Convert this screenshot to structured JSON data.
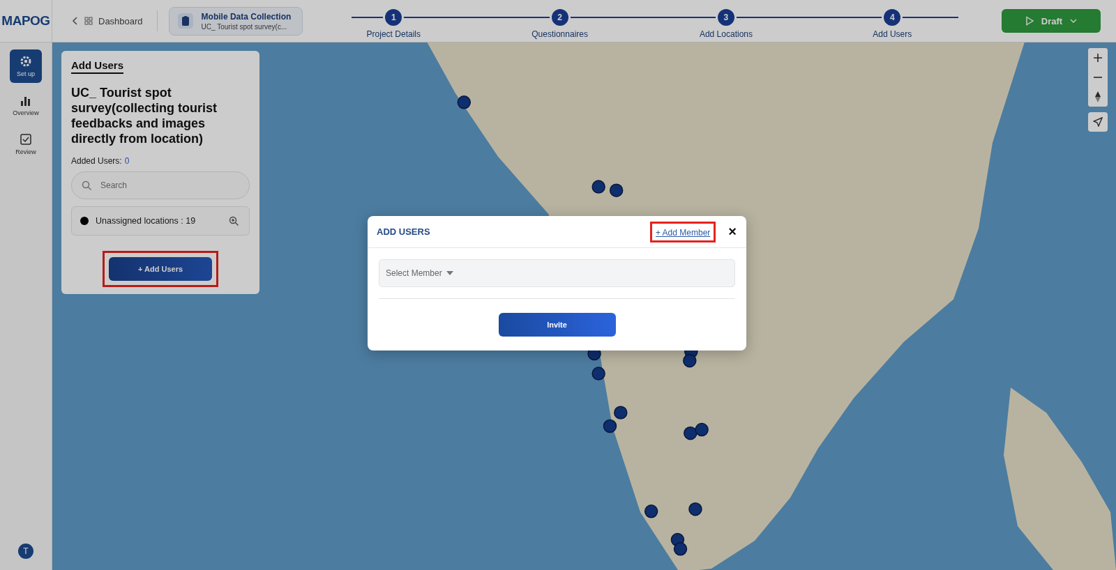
{
  "brand": {
    "logo": "MAPOG"
  },
  "breadcrumb": {
    "label": "Dashboard"
  },
  "project": {
    "title": "Mobile Data Collection",
    "subtitle": "UC_ Tourist spot survey(c..."
  },
  "steps": [
    {
      "number": "1",
      "label": "Project Details"
    },
    {
      "number": "2",
      "label": "Questionnaires"
    },
    {
      "number": "3",
      "label": "Add Locations"
    },
    {
      "number": "4",
      "label": "Add Users"
    }
  ],
  "draft_button": {
    "label": "Draft"
  },
  "sidebar": {
    "items": [
      {
        "label": "Set up",
        "selected": true
      },
      {
        "label": "Overview",
        "selected": false
      },
      {
        "label": "Review",
        "selected": false
      }
    ],
    "avatar": "T"
  },
  "panel": {
    "tab": "Add Users",
    "title": "UC_ Tourist spot survey(collecting tourist feedbacks and images directly from location)",
    "added_label": "Added Users:",
    "added_count": "0",
    "search": {
      "placeholder": "Search"
    },
    "unassigned": {
      "label": "Unassigned locations : 19",
      "color": "#000000"
    },
    "add_button": "+ Add Users",
    "add_button_highlighted": true
  },
  "modal": {
    "title": "ADD USERS",
    "add_member": "+ Add Member",
    "add_member_highlighted": true,
    "close": "×",
    "select": {
      "placeholder": "Select Member"
    },
    "invite": "Invite"
  }
}
